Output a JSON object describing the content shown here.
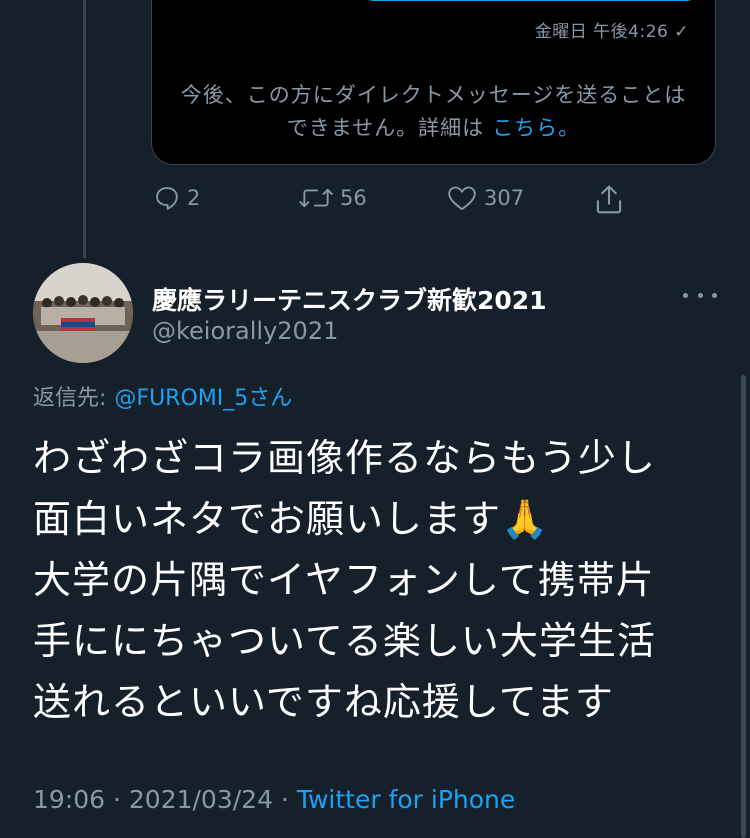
{
  "dm_preview": {
    "time": "金曜日 午後4:26 ✓",
    "notice": "今後、この方にダイレクトメッセージを送ることはできません。詳細は",
    "link_label": "こちら。"
  },
  "previous_tweet_actions": {
    "reply_count": "2",
    "retweet_count": "56",
    "like_count": "307"
  },
  "tweet": {
    "display_name": "慶應ラリーテニスクラブ新歓2021",
    "handle": "@keiorally2021",
    "replying_prefix": "返信先:",
    "replying_to": "@FUROMI_5さん",
    "text": "わざわざコラ画像作るならもう少し\n面白いネタでお願いします🙏\n大学の片隅でイヤフォンして携帯片\n手ににちゃついてる楽しい大学生活\n送れるといいですね応援してます",
    "timestamp": "19:06 · 2021/03/24 · ",
    "source": "Twitter for iPhone"
  },
  "colors": {
    "background": "#15202b",
    "secondary_text": "#8899a6",
    "accent": "#1da1f2",
    "card_background": "#000000",
    "border": "#38444d"
  },
  "icons": [
    "reply-icon",
    "retweet-icon",
    "like-icon",
    "share-icon",
    "more-options-icon"
  ]
}
